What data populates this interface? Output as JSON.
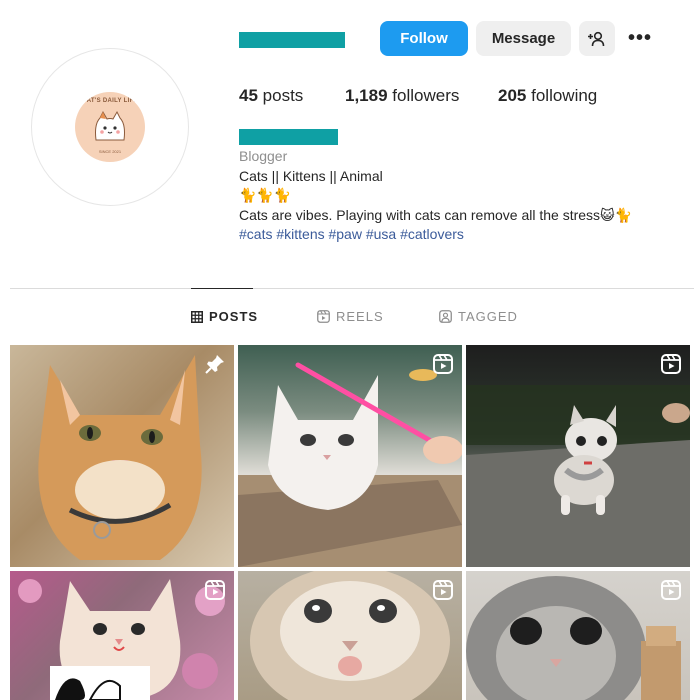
{
  "header": {
    "follow_label": "Follow",
    "message_label": "Message",
    "suggest_icon": "add-person-icon",
    "more_icon": "more-options-icon",
    "more_glyph": "•••"
  },
  "avatar": {
    "text_top": "CAT'S DAILY LIFE",
    "text_bottom": "SINCE 2021"
  },
  "stats": {
    "posts_count": "45",
    "posts_label": "posts",
    "followers_count": "1,189",
    "followers_label": "followers",
    "following_count": "205",
    "following_label": "following"
  },
  "bio": {
    "category": "Blogger",
    "line1": "Cats || Kittens || Animal",
    "line2": "🐈🐈🐈",
    "line3": "Cats are vibes. Playing with cats can remove all the stress😺🐈",
    "hashtags": "#cats #kittens #paw #usa #catlovers"
  },
  "tabs": [
    {
      "label": "POSTS",
      "icon": "grid-icon",
      "active": true
    },
    {
      "label": "REELS",
      "icon": "reels-icon",
      "active": false
    },
    {
      "label": "TAGGED",
      "icon": "tagged-icon",
      "active": false
    }
  ],
  "posts": [
    {
      "subject": "orange tabby cat with collar",
      "badge": "pin-icon"
    },
    {
      "subject": "white cat with pink toy",
      "badge": "reels-icon"
    },
    {
      "subject": "grey and white kitten walking at night",
      "badge": "reels-icon"
    },
    {
      "subject": "fluffy white kitten among flowers",
      "badge": "reels-icon"
    },
    {
      "subject": "fluffy kitten close-up",
      "badge": "reels-icon"
    },
    {
      "subject": "grey kitten close-up",
      "badge": "reels-icon"
    }
  ],
  "colors": {
    "follow_button": "#1d9bf0",
    "redacted_bar": "#0fa0a4",
    "hashtag": "#3b5b9a"
  }
}
